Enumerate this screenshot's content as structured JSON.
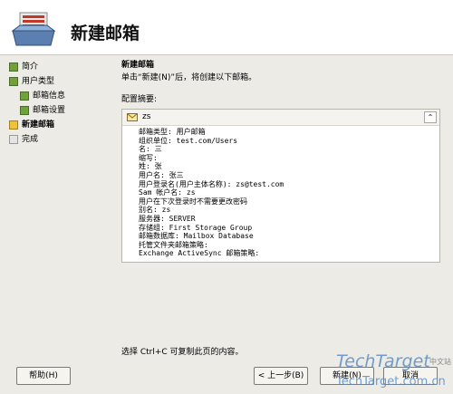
{
  "header": {
    "title": "新建邮箱"
  },
  "sidebar": {
    "items": [
      {
        "label": "简介"
      },
      {
        "label": "用户类型"
      },
      {
        "label": "邮箱信息"
      },
      {
        "label": "邮箱设置"
      },
      {
        "label": "新建邮箱"
      },
      {
        "label": "完成"
      }
    ]
  },
  "main": {
    "step_title": "新建邮箱",
    "step_desc": "单击“新建(N)”后，将创建以下邮箱。",
    "summary_label": "配置摘要:",
    "panel": {
      "name": "zs",
      "collapse_glyph": "⌃",
      "details": [
        "邮箱类型: 用户邮箱",
        "组织单位: test.com/Users",
        "名: 三",
        "缩写:",
        "姓: 张",
        "用户名: 张三",
        "用户登录名(用户主体名称): zs@test.com",
        "Sam 帐户名: zs",
        "用户在下次登录时不需要更改密码",
        "别名: zs",
        "服务器: SERVER",
        "存储组: First Storage Group",
        "邮箱数据库: Mailbox Database",
        "托管文件夹邮箱策略:",
        "Exchange ActiveSync 邮箱策略:"
      ]
    },
    "hint": "选择 Ctrl+C 可复制此页的内容。"
  },
  "buttons": {
    "help": "帮助(H)",
    "back": "< 上一步(B)",
    "new": "新建(N)",
    "cancel": "取消"
  },
  "watermark": {
    "brand": "TechTarget",
    "cn": "中文站",
    "url": "TechTarget.com.cn"
  },
  "colors": {
    "done_step": "#6fa33a",
    "current_step": "#f0c23a",
    "pending_step": "#e4e4e4",
    "watermark": "#5b8fc7"
  }
}
